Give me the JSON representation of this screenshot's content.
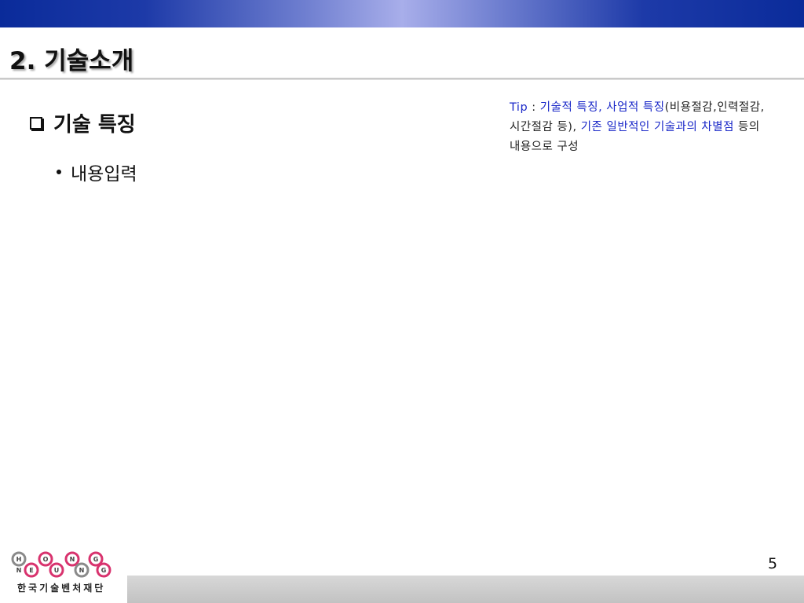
{
  "slide": {
    "title": "2. 기술소개",
    "heading": "기술 특징",
    "bullet": "내용입력",
    "page_number": "5"
  },
  "tip": {
    "label": "Tip",
    "colon": " : ",
    "part1_blue": "기술적 특징, 사업적 특징",
    "part2": "(비용절감,인력절감,시간절감 등), ",
    "part3_blue": "기존 일반적인 기술과의 차별점",
    "part4": " 등의 내용으로 구성"
  },
  "logo": {
    "letters_top": [
      "H",
      "O",
      "N",
      "G"
    ],
    "letters_bottom": [
      "N",
      "E",
      "U",
      "N",
      "G"
    ],
    "org_name": "한국기술벤처재단"
  },
  "colors": {
    "band_dark": "#0a2b9a",
    "band_light": "#a8aeea",
    "tip_blue": "#1a28c8",
    "logo_pink": "#d8336e",
    "logo_gray": "#8a8a8a"
  }
}
